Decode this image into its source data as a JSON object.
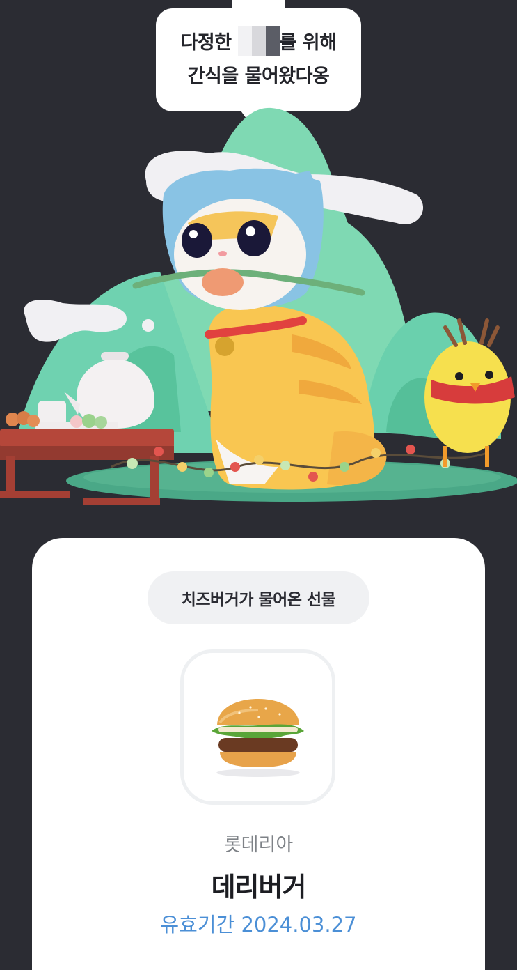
{
  "bubble": {
    "line1_prefix": "다정한 ",
    "line1_suffix": "를 위해",
    "line2": "간식을 물어왔다옹"
  },
  "card": {
    "gift_label": "치즈버거가 물어온 선물",
    "brand": "롯데리아",
    "product_name": "데리버거",
    "expiry_label": "유효기간",
    "expiry_date": "2024.03.27"
  },
  "colors": {
    "background": "#2b2c33",
    "card": "#ffffff",
    "chip": "#f0f1f3",
    "expiry": "#4b8fd6"
  },
  "icons": [
    "cat-illustration",
    "chick-illustration",
    "burger-image"
  ]
}
